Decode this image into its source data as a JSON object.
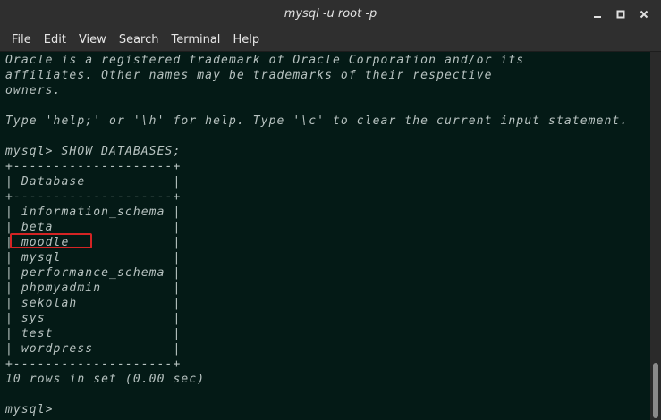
{
  "window": {
    "title": "mysql -u root -p"
  },
  "menu": {
    "items": [
      "File",
      "Edit",
      "View",
      "Search",
      "Terminal",
      "Help"
    ]
  },
  "terminal": {
    "lines": [
      "Oracle is a registered trademark of Oracle Corporation and/or its",
      "affiliates. Other names may be trademarks of their respective",
      "owners.",
      "",
      "Type 'help;' or '\\h' for help. Type '\\c' to clear the current input statement.",
      "",
      "mysql> SHOW DATABASES;",
      "+--------------------+",
      "| Database           |",
      "+--------------------+",
      "| information_schema |",
      "| beta               |",
      "| moodle             |",
      "| mysql              |",
      "| performance_schema |",
      "| phpmyadmin         |",
      "| sekolah            |",
      "| sys                |",
      "| test               |",
      "| wordpress          |",
      "+--------------------+",
      "10 rows in set (0.00 sec)",
      "",
      "mysql> "
    ],
    "highlighted_database": "moodle",
    "highlight_color": "#d42424"
  },
  "colors": {
    "terminal_bg": "#041a16",
    "terminal_fg": "#b7c2c0",
    "titlebar_bg": "#2f2f2f"
  }
}
